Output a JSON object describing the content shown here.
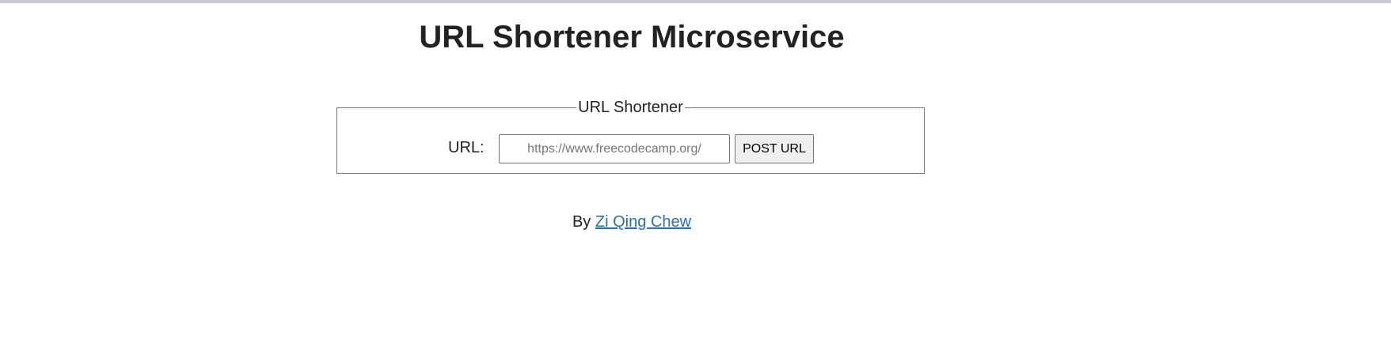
{
  "header": {
    "title": "URL Shortener Microservice"
  },
  "form": {
    "legend": "URL Shortener",
    "url_label": "URL:",
    "url_placeholder": "https://www.freecodecamp.org/",
    "url_value": "",
    "submit_label": "POST URL"
  },
  "footer": {
    "by_text": "By",
    "author_name": "Zi Qing Chew"
  },
  "colors": {
    "link": "#2a6fb5",
    "text": "#222222",
    "border": "#767676"
  }
}
